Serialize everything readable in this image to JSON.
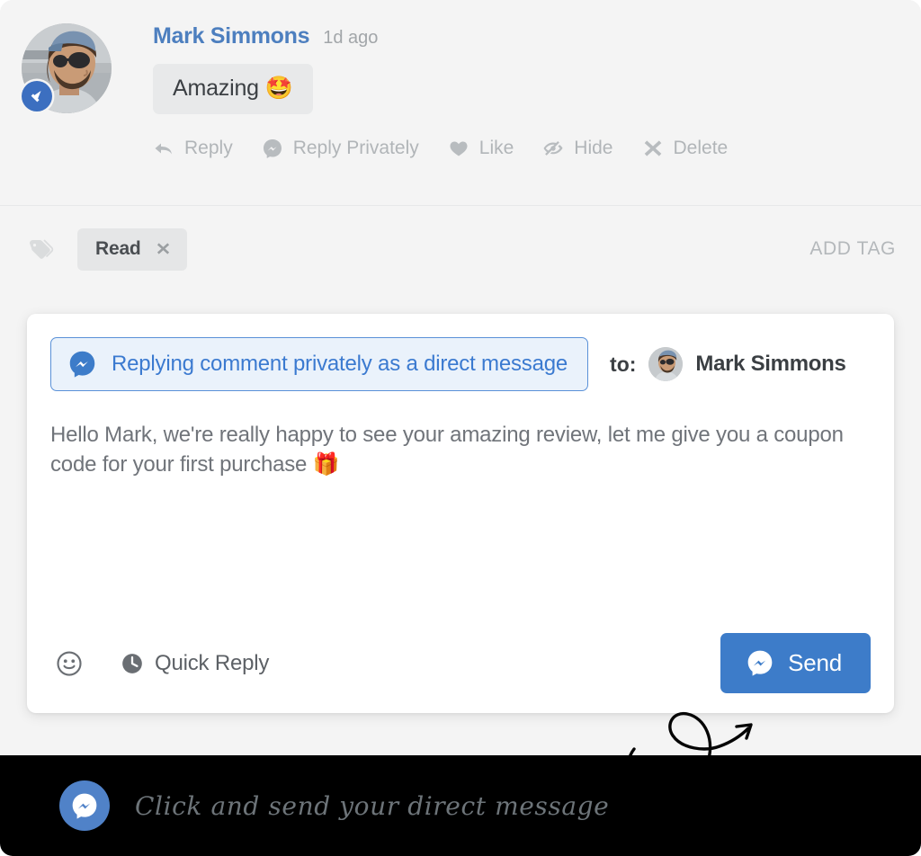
{
  "comment": {
    "author": "Mark Simmons",
    "time": "1d ago",
    "text": "Amazing 🤩",
    "avatar_badge_icon": "megaphone-icon",
    "actions": [
      {
        "label": "Reply",
        "icon": "reply-arrow-icon"
      },
      {
        "label": "Reply Privately",
        "icon": "messenger-icon"
      },
      {
        "label": "Like",
        "icon": "heart-icon"
      },
      {
        "label": "Hide",
        "icon": "eye-slash-icon"
      },
      {
        "label": "Delete",
        "icon": "close-x-icon"
      }
    ]
  },
  "tag_bar": {
    "tag_icon": "tag-icon",
    "tags": [
      {
        "label": "Read",
        "remove_icon": "close-x-icon"
      }
    ],
    "add_tag_label": "ADD TAG"
  },
  "composer": {
    "reply_mode_label": "Replying comment privately as a direct message",
    "reply_mode_icon": "messenger-icon",
    "to_label": "to:",
    "recipient": "Mark Simmons",
    "message": "Hello Mark, we're really happy to see your amazing review, let me give you a coupon code for your first purchase 🎁",
    "emoji_icon": "smiley-icon",
    "quick_reply_label": "Quick Reply",
    "quick_reply_icon": "clock-icon",
    "send_label": "Send",
    "send_icon": "messenger-icon"
  },
  "banner": {
    "icon": "messenger-icon",
    "text": "Click and send your direct message"
  },
  "colors": {
    "accent_blue": "#3d7cc9",
    "link_blue": "#4d7fbf",
    "page_bg": "#f4f4f4",
    "banner_bg": "#000000",
    "muted_gray": "#b1b5b8"
  }
}
